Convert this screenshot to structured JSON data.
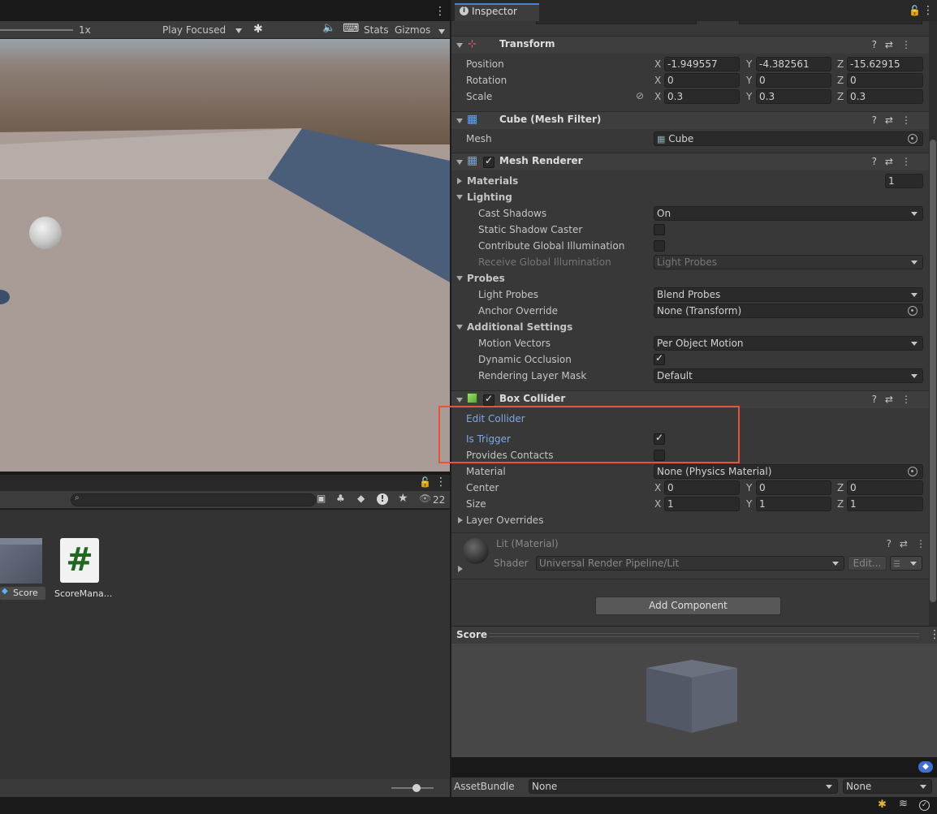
{
  "game_toolbar": {
    "scale_label": "1x",
    "play_mode": "Play Focused",
    "stats": "Stats",
    "gizmos": "Gizmos"
  },
  "project": {
    "search_placeholder": "",
    "visible_count": "22",
    "assets": [
      {
        "label": "Score",
        "icon": "prefab-cube-icon"
      },
      {
        "label": "ScoreMana...",
        "icon": "csharp-script-icon"
      }
    ]
  },
  "inspector": {
    "tab": "Inspector",
    "transform": {
      "title": "Transform",
      "rows": [
        {
          "label": "Position",
          "x": "-1.949557",
          "y": "-4.382561",
          "z": "-15.62915"
        },
        {
          "label": "Rotation",
          "x": "0",
          "y": "0",
          "z": "0"
        },
        {
          "label": "Scale",
          "x": "0.3",
          "y": "0.3",
          "z": "0.3"
        }
      ]
    },
    "mesh_filter": {
      "title": "Cube (Mesh Filter)",
      "mesh_label": "Mesh",
      "mesh_value": "Cube"
    },
    "mesh_renderer": {
      "title": "Mesh Renderer",
      "materials_label": "Materials",
      "materials_count": "1",
      "lighting": "Lighting",
      "cast_shadows_label": "Cast Shadows",
      "cast_shadows_value": "On",
      "static_shadow_label": "Static Shadow Caster",
      "contribute_gi_label": "Contribute Global Illumination",
      "receive_gi_label": "Receive Global Illumination",
      "receive_gi_value": "Light Probes",
      "probes": "Probes",
      "light_probes_label": "Light Probes",
      "light_probes_value": "Blend Probes",
      "anchor_label": "Anchor Override",
      "anchor_value": "None (Transform)",
      "additional": "Additional Settings",
      "motion_label": "Motion Vectors",
      "motion_value": "Per Object Motion",
      "dyn_occ_label": "Dynamic Occlusion",
      "layer_mask_label": "Rendering Layer Mask",
      "layer_mask_value": "Default"
    },
    "box_collider": {
      "title": "Box Collider",
      "edit_collider": "Edit Collider",
      "is_trigger": "Is Trigger",
      "provides_contacts": "Provides Contacts",
      "material_label": "Material",
      "material_value": "None (Physics Material)",
      "center_label": "Center",
      "center": {
        "x": "0",
        "y": "0",
        "z": "0"
      },
      "size_label": "Size",
      "size": {
        "x": "1",
        "y": "1",
        "z": "1"
      },
      "layer_overrides": "Layer Overrides"
    },
    "material": {
      "title": "Lit (Material)",
      "shader_label": "Shader",
      "shader_value": "Universal Render Pipeline/Lit",
      "edit_button": "Edit..."
    },
    "add_component": "Add Component",
    "preview_title": "Score",
    "asset_bundle_label": "AssetBundle",
    "asset_bundle_value": "None",
    "asset_bundle_variant": "None"
  },
  "axes": {
    "x": "X",
    "y": "Y",
    "z": "Z"
  },
  "colors": {
    "highlight_box": "#e8533a",
    "link_blue": "#7ea7e8",
    "accent_blue": "#4a7fd8"
  }
}
